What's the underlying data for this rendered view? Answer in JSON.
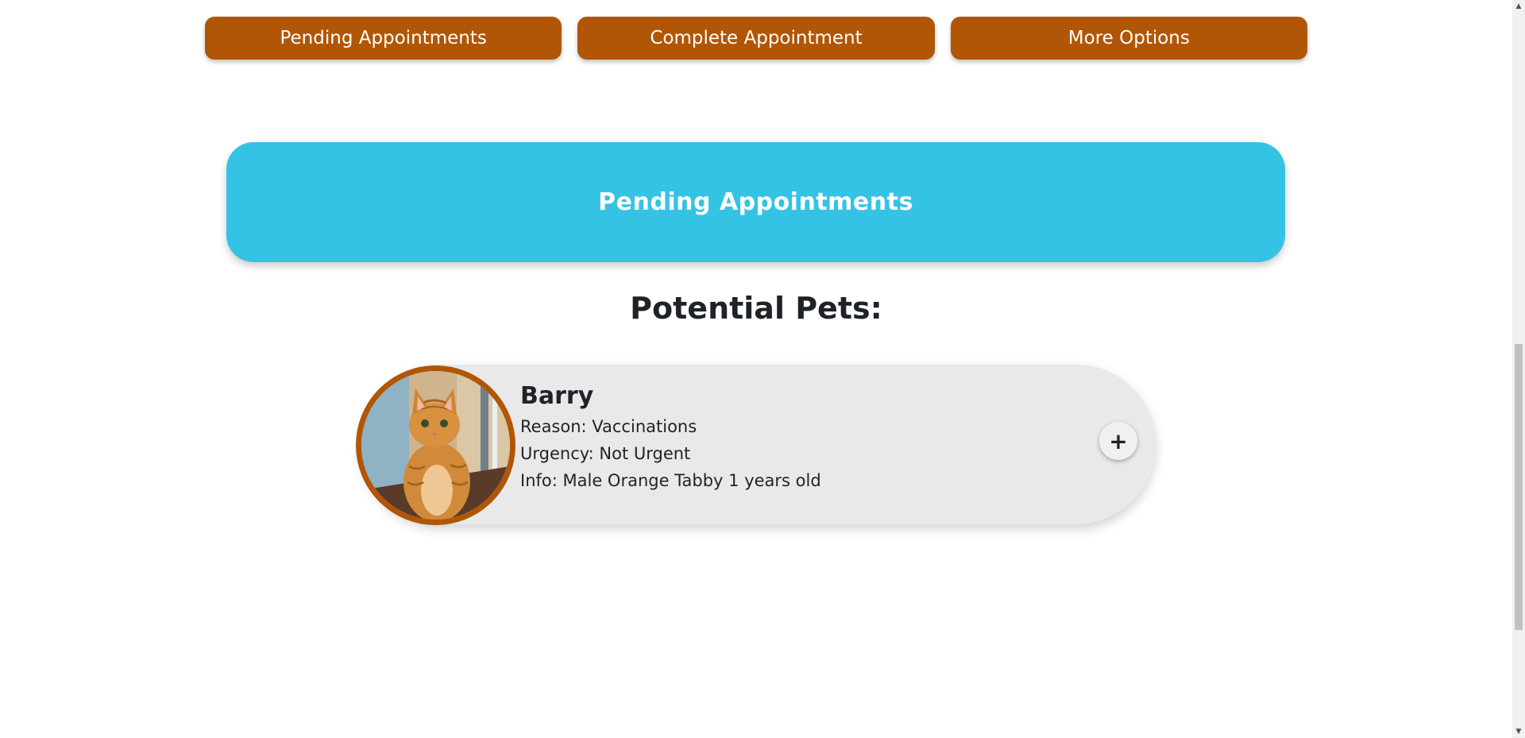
{
  "nav": {
    "buttons": [
      {
        "label": "Pending Appointments"
      },
      {
        "label": "Complete Appointment"
      },
      {
        "label": "More Options"
      }
    ]
  },
  "banner": {
    "title": "Pending Appointments"
  },
  "section": {
    "heading": "Potential Pets:"
  },
  "pets": [
    {
      "name": "Barry",
      "reason": "Reason: Vaccinations",
      "urgency": "Urgency: Not Urgent",
      "info": "Info: Male Orange Tabby 1 years old",
      "add_symbol": "+",
      "photo_icon": "cat-photo"
    }
  ],
  "colors": {
    "accent": "#b05606",
    "banner": "#35c3e5",
    "card": "#e9e9e9"
  },
  "scrollbar": {
    "up_arrow": "▲",
    "down_arrow": "▼"
  }
}
